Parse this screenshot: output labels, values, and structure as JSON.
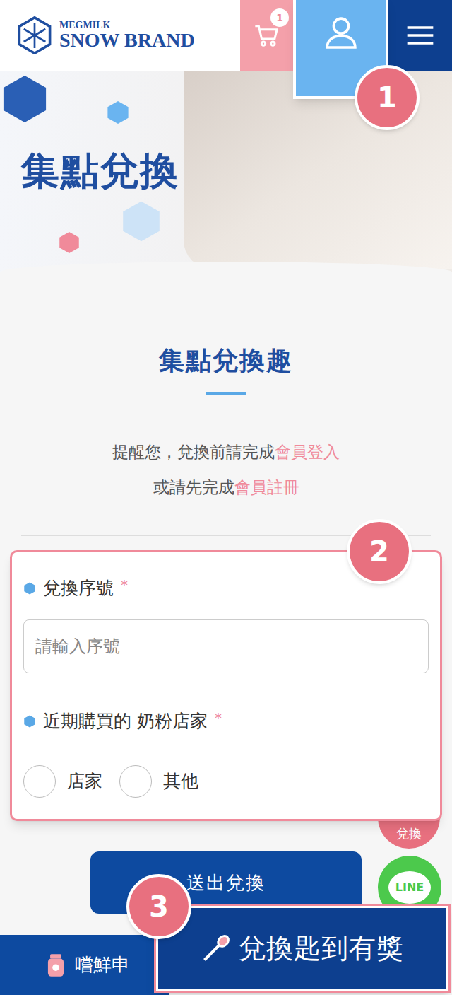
{
  "header": {
    "logo_top": "MEGMILK",
    "logo_bottom": "SNOW BRAND",
    "cart_badge": "1"
  },
  "hero": {
    "title": "集點兌換"
  },
  "section": {
    "title": "集點兌換趣",
    "notice_line1_prefix": "提醒您，兌換前請完成",
    "login_link": "會員登入",
    "notice_line2_prefix": "或請先完成",
    "register_link": "會員註冊"
  },
  "form": {
    "serial": {
      "label": "兌換序號",
      "required": "*",
      "placeholder": "請輸入序號"
    },
    "store": {
      "label": "近期購買的 奶粉店家",
      "required": "*",
      "options": [
        {
          "label": "店家",
          "selected": false
        },
        {
          "label": "其他",
          "selected": false
        }
      ]
    }
  },
  "submit_button": "送出兌換",
  "floating": {
    "redeem": "兌換",
    "line": "LINE"
  },
  "bottom_bar": {
    "trial": "嚐鮮申",
    "redeem": "兌換匙到有獎"
  },
  "callouts": [
    "1",
    "2",
    "3"
  ]
}
